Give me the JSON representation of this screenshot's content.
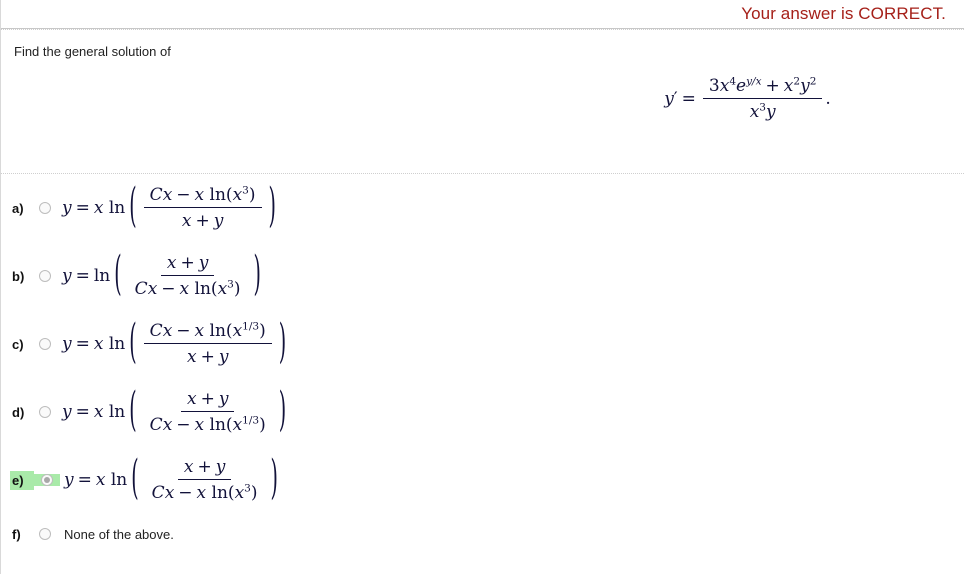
{
  "header": {
    "verdict": "Your answer is CORRECT.",
    "verdict_color": "#a52019"
  },
  "question": {
    "prompt": "Find the general solution of",
    "equation_plain": "y' = (3x^4 e^(y/x) + x^2 y^2) / (x^3 y).",
    "lhs": "y",
    "lhs_prime": "′",
    "equals": "=",
    "numerator": {
      "coefficient": "3",
      "x_sym": "x",
      "x_exp": "4",
      "e_sym": "e",
      "e_exp": "y/x",
      "plus": "+",
      "x2_sym": "x",
      "x2_exp": "2",
      "y2_sym": "y",
      "y2_exp": "2"
    },
    "denominator": {
      "x_sym": "x",
      "x_exp": "3",
      "y_sym": "y"
    },
    "period": "."
  },
  "options": [
    {
      "id": "a",
      "label": "a)",
      "selected": false,
      "highlighted": false,
      "kind": "math",
      "text_plain": "y = x ln( (Cx - x ln(x^3)) / (x + y) )",
      "prefix_y": "y",
      "prefix_eq": "=",
      "prefix_x": "x",
      "prefix_ln": "ln",
      "numerator_plain": "Cx - x ln(x^3)",
      "num_C": "C",
      "num_x1": "x",
      "num_minus": "−",
      "num_x2": "x",
      "num_ln": "ln",
      "num_open": "(",
      "num_arg": "x",
      "num_exp": "3",
      "num_close": ")",
      "den_x": "x",
      "den_plus": "+",
      "den_y": "y"
    },
    {
      "id": "b",
      "label": "b)",
      "selected": false,
      "highlighted": false,
      "kind": "math",
      "text_plain": "y = ln( (x + y) / (Cx - x ln(x^3)) )",
      "prefix_y": "y",
      "prefix_eq": "=",
      "prefix_x": "",
      "prefix_ln": "ln",
      "numerator_plain": "x + y",
      "num_x": "x",
      "num_plus": "+",
      "num_y": "y",
      "den_C": "C",
      "den_x1": "x",
      "den_minus": "−",
      "den_x2": "x",
      "den_ln": "ln",
      "den_open": "(",
      "den_arg": "x",
      "den_exp": "3",
      "den_close": ")"
    },
    {
      "id": "c",
      "label": "c)",
      "selected": false,
      "highlighted": false,
      "kind": "math",
      "text_plain": "y = x ln( (Cx - x ln(x^(1/3))) / (x + y) )",
      "prefix_y": "y",
      "prefix_eq": "=",
      "prefix_x": "x",
      "prefix_ln": "ln",
      "numerator_plain": "Cx - x ln(x^(1/3))",
      "num_C": "C",
      "num_x1": "x",
      "num_minus": "−",
      "num_x2": "x",
      "num_ln": "ln",
      "num_open": "(",
      "num_arg": "x",
      "num_exp": "1/3",
      "num_close": ")",
      "den_x": "x",
      "den_plus": "+",
      "den_y": "y"
    },
    {
      "id": "d",
      "label": "d)",
      "selected": false,
      "highlighted": false,
      "kind": "math",
      "text_plain": "y = x ln( (x + y) / (Cx - x ln(x^(1/3))) )",
      "prefix_y": "y",
      "prefix_eq": "=",
      "prefix_x": "x",
      "prefix_ln": "ln",
      "numerator_plain": "x + y",
      "num_x": "x",
      "num_plus": "+",
      "num_y": "y",
      "den_C": "C",
      "den_x1": "x",
      "den_minus": "−",
      "den_x2": "x",
      "den_ln": "ln",
      "den_open": "(",
      "den_arg": "x",
      "den_exp": "1/3",
      "den_close": ")"
    },
    {
      "id": "e",
      "label": "e)",
      "selected": true,
      "highlighted": true,
      "kind": "math",
      "text_plain": "y = x ln( (x + y) / (Cx - x ln(x^3)) )",
      "prefix_y": "y",
      "prefix_eq": "=",
      "prefix_x": "x",
      "prefix_ln": "ln",
      "numerator_plain": "x + y",
      "num_x": "x",
      "num_plus": "+",
      "num_y": "y",
      "den_C": "C",
      "den_x1": "x",
      "den_minus": "−",
      "den_x2": "x",
      "den_ln": "ln",
      "den_open": "(",
      "den_arg": "x",
      "den_exp": "3",
      "den_close": ")"
    },
    {
      "id": "f",
      "label": "f)",
      "selected": false,
      "highlighted": false,
      "kind": "text",
      "text_plain": "None of the above."
    }
  ],
  "colors": {
    "highlight_green": "#a9eaa9",
    "math_ink": "#12123a",
    "rule": "#cfcfcf"
  }
}
